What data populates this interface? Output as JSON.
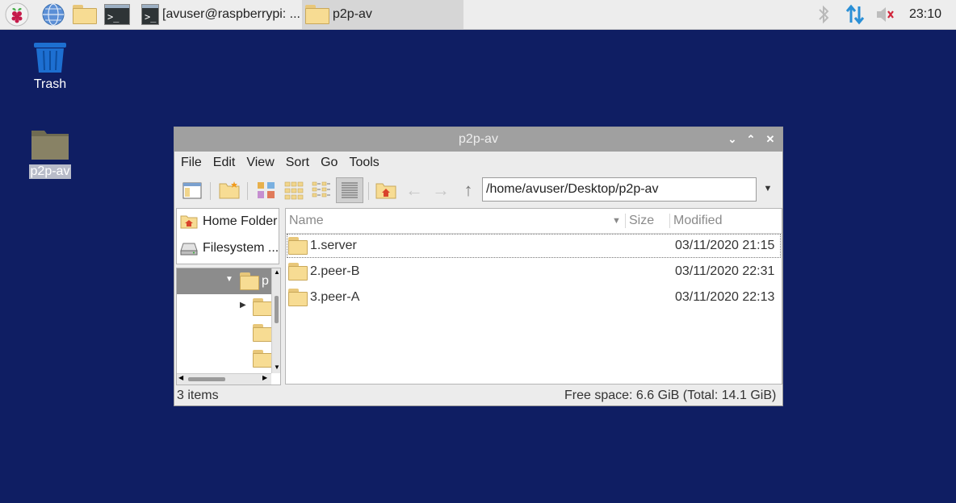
{
  "panel": {
    "tasks": [
      {
        "label": "[avuser@raspberrypi: ..."
      },
      {
        "label": "p2p-av"
      }
    ],
    "clock": "23:10"
  },
  "desktop": {
    "icons": [
      {
        "label": "Trash"
      },
      {
        "label": "p2p-av"
      }
    ]
  },
  "window": {
    "title": "p2p-av",
    "menu": [
      "File",
      "Edit",
      "View",
      "Sort",
      "Go",
      "Tools"
    ],
    "path": "/home/avuser/Desktop/p2p-av",
    "places": [
      {
        "label": "Home Folder"
      },
      {
        "label": "Filesystem ..."
      }
    ],
    "tree_selected_label": "p",
    "columns": {
      "name": "Name",
      "size": "Size",
      "modified": "Modified"
    },
    "files": [
      {
        "name": "1.server",
        "size": "",
        "modified": "03/11/2020 21:15"
      },
      {
        "name": "2.peer-B",
        "size": "",
        "modified": "03/11/2020 22:31"
      },
      {
        "name": "3.peer-A",
        "size": "",
        "modified": "03/11/2020 22:13"
      }
    ],
    "status": {
      "count": "3 items",
      "free": "Free space: 6.6 GiB (Total: 14.1 GiB)"
    }
  },
  "colors": {
    "desktop_bg": "#0f1e63",
    "panel_bg": "#ededed",
    "titlebar": "#a0a0a0",
    "folder": "#f7dc93",
    "accent_blue": "#2a8fd6",
    "mute_red": "#d0243a"
  }
}
